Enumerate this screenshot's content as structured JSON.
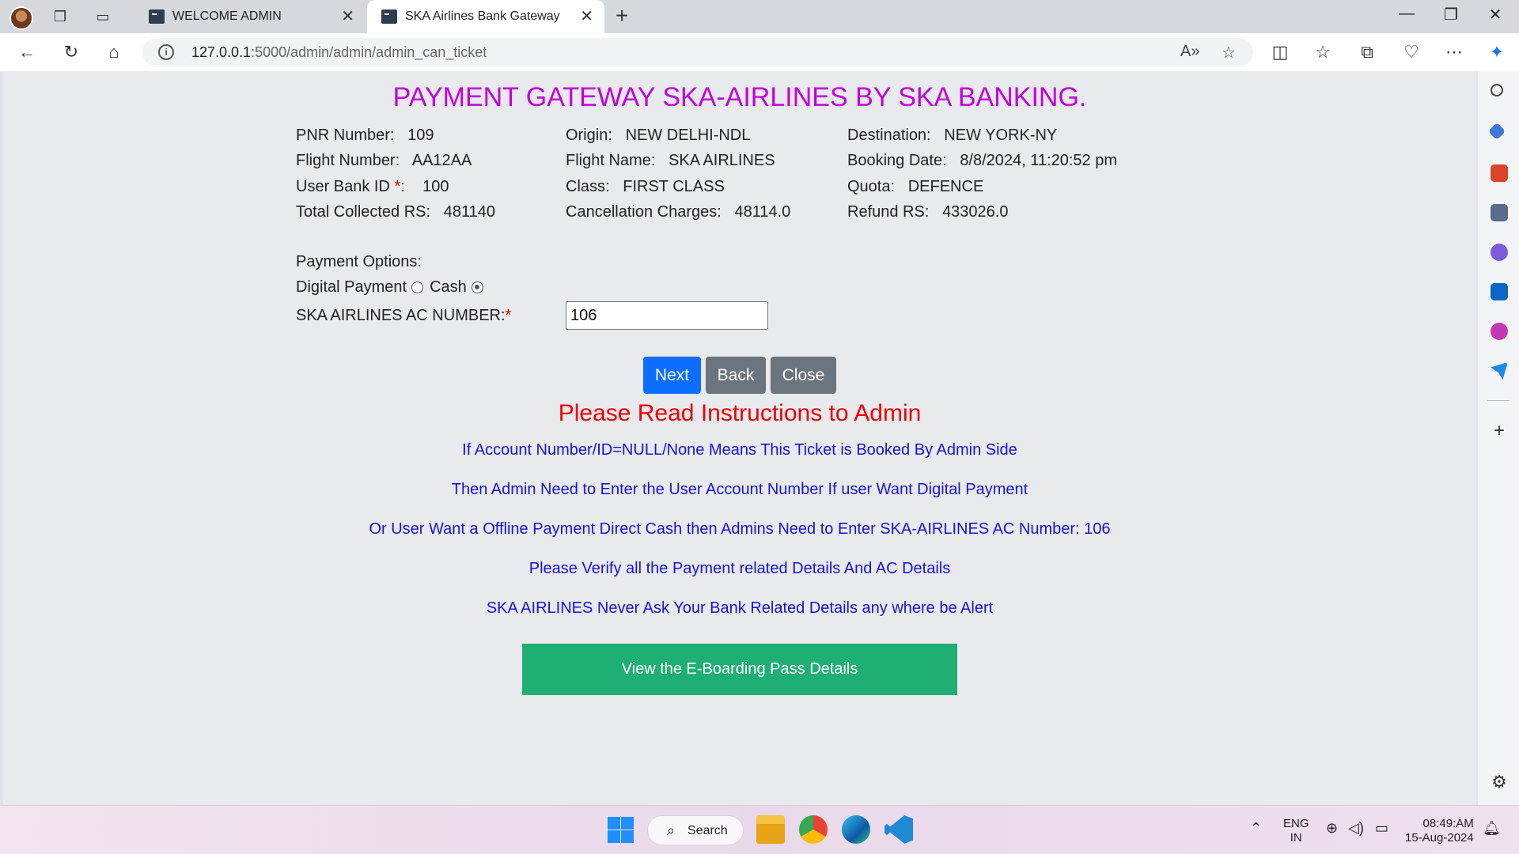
{
  "browser": {
    "tabs": [
      {
        "title": "WELCOME ADMIN",
        "active": false
      },
      {
        "title": "SKA Airlines Bank Gateway",
        "active": true
      }
    ],
    "url_host": "127.0.0.1",
    "url_path": ":5000/admin/admin/admin_can_ticket"
  },
  "page": {
    "title": "PAYMENT GATEWAY SKA-AIRLINES BY SKA BANKING.",
    "details": {
      "pnr_label": "PNR Number:",
      "pnr_value": "109",
      "origin_label": "Origin:",
      "origin_value": "NEW DELHI-NDL",
      "destination_label": "Destination:",
      "destination_value": "NEW YORK-NY",
      "flight_number_label": "Flight Number:",
      "flight_number_value": "AA12AA",
      "flight_name_label": "Flight Name:",
      "flight_name_value": "SKA AIRLINES",
      "booking_date_label": "Booking Date:",
      "booking_date_value": "8/8/2024, 11:20:52 pm",
      "user_bank_id_label": "User Bank ID ",
      "user_bank_id_req": "*",
      "user_bank_id_colon": ":",
      "user_bank_id_value": "100",
      "class_label": "Class:",
      "class_value": "FIRST CLASS",
      "quota_label": "Quota:",
      "quota_value": "DEFENCE",
      "total_label": "Total Collected RS:",
      "total_value": "481140",
      "cancel_label": "Cancellation Charges:",
      "cancel_value": "48114.0",
      "refund_label": "Refund RS:",
      "refund_value": "433026.0"
    },
    "payment": {
      "options_label": "Payment Options:",
      "digital_label": "Digital Payment",
      "digital_selected": false,
      "cash_label": "Cash",
      "cash_selected": true,
      "ac_label": "SKA AIRLINES AC NUMBER:",
      "ac_req": "*",
      "ac_value": "106"
    },
    "buttons": {
      "next": "Next",
      "back": "Back",
      "close": "Close"
    },
    "instructions_title": "Please Read Instructions to Admin",
    "instructions": [
      "If Account Number/ID=NULL/None Means This Ticket is Booked By Admin Side",
      "Then Admin Need to Enter the User Account Number If user Want Digital Payment",
      "Or User Want a Offline Payment Direct Cash then Admins Need to Enter SKA-AIRLINES AC Number: 106",
      "Please Verify all the Payment related Details And AC Details",
      "SKA AIRLINES Never Ask Your Bank Related Details any where be Alert"
    ],
    "eboarding_button": "View the E-Boarding Pass Details"
  },
  "taskbar": {
    "search_label": "Search",
    "lang_line1": "ENG",
    "lang_line2": "IN",
    "time": "08:49:AM",
    "date": "15-Aug-2024"
  }
}
